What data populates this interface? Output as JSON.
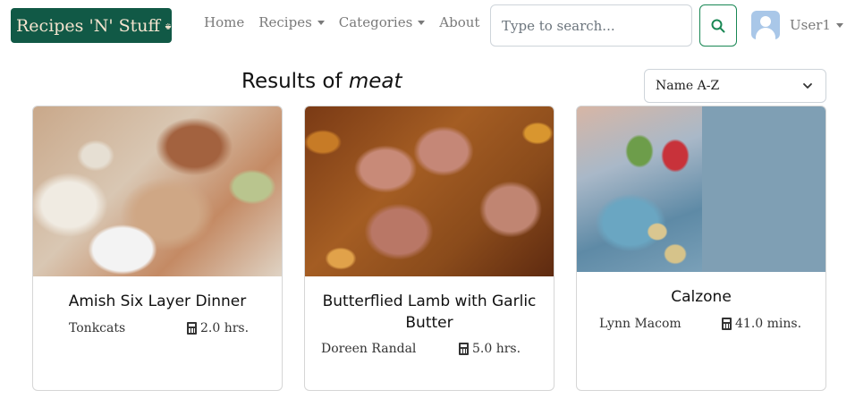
{
  "navbar": {
    "brand": "Recipes 'N' Stuff",
    "links": [
      {
        "label": "Home",
        "dropdown": false
      },
      {
        "label": "Recipes",
        "dropdown": true
      },
      {
        "label": "Categories",
        "dropdown": true
      },
      {
        "label": "About",
        "dropdown": false
      }
    ],
    "search": {
      "placeholder": "Type to search...",
      "value": ""
    },
    "user": "User1"
  },
  "results": {
    "prefix": "Results of ",
    "query": "meat",
    "sort": {
      "selected": "Name A-Z"
    }
  },
  "recipes": [
    {
      "title": "Amish Six Layer Dinner",
      "author": "Tonkcats",
      "time": "2.0 hrs."
    },
    {
      "title": "Butterflied Lamb with Garlic Butter",
      "author": "Doreen Randal",
      "time": "5.0 hrs."
    },
    {
      "title": "Calzone",
      "author": "Lynn Macom",
      "time": "41.0 mins."
    }
  ],
  "colors": {
    "brand_bg": "#115946",
    "brand_text": "#f4e4cf",
    "search_button_border": "#198754",
    "nav_text": "#7a7a7a"
  },
  "icons": {
    "brand": "bowl-icon",
    "search": "search-icon",
    "user": "user-avatar-icon",
    "time": "calculator-icon",
    "dropdown": "caret-down-icon"
  }
}
